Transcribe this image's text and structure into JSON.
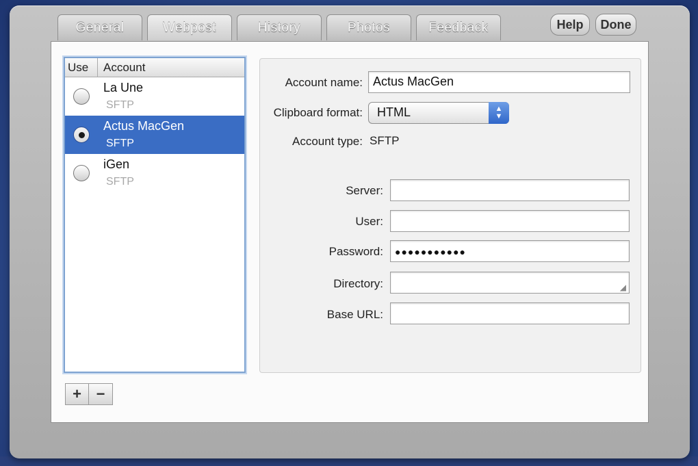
{
  "tabs": [
    "General",
    "Webpost",
    "History",
    "Photos",
    "Feedback"
  ],
  "buttons": {
    "help": "Help",
    "done": "Done"
  },
  "accounts": {
    "header": {
      "use": "Use",
      "account": "Account"
    },
    "items": [
      {
        "name": "La Une",
        "type": "SFTP",
        "selected": false
      },
      {
        "name": "Actus MacGen",
        "type": "SFTP",
        "selected": true
      },
      {
        "name": "iGen",
        "type": "SFTP",
        "selected": false
      }
    ],
    "add_label": "+",
    "remove_label": "−"
  },
  "form": {
    "account_name_label": "Account name:",
    "account_name_value": "Actus MacGen",
    "clipboard_label": "Clipboard format:",
    "clipboard_value": "HTML",
    "account_type_label": "Account type:",
    "account_type_value": "SFTP",
    "server_label": "Server:",
    "server_value": "",
    "user_label": "User:",
    "user_value": "",
    "password_label": "Password:",
    "password_value": "●●●●●●●●●●●",
    "directory_label": "Directory:",
    "directory_value": "",
    "base_url_label": "Base URL:",
    "base_url_value": ""
  },
  "colors": {
    "selection": "#3a6dc4",
    "focus_ring": "#7ea3d1",
    "popup_arrows": "#2f66c9"
  },
  "icons": {
    "popup_arrows": "updown-arrows-icon",
    "resize_grip": "resize-grip-icon"
  }
}
